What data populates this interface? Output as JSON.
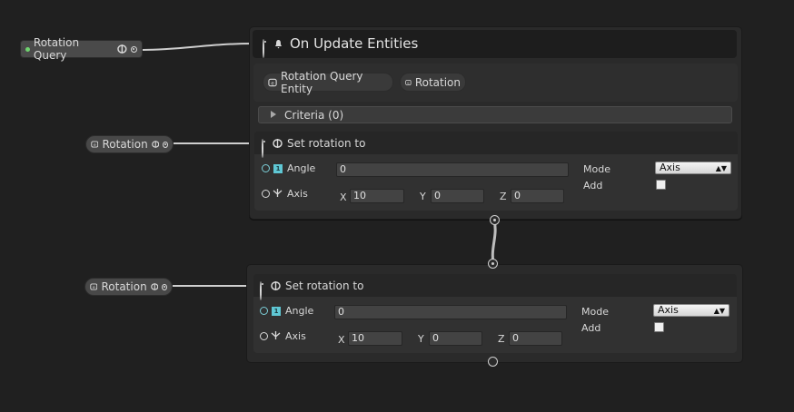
{
  "variables": {
    "rotation_query": "Rotation Query",
    "rotation_1": "Rotation",
    "rotation_2": "Rotation"
  },
  "event_node": {
    "title": "On Update Entities",
    "entity_tags": [
      "Rotation Query Entity",
      "Rotation"
    ],
    "criteria_label": "Criteria (0)"
  },
  "nodes": [
    {
      "title": "Set rotation to",
      "angle_label": "Angle",
      "angle_value": "0",
      "axis_label": "Axis",
      "axis_x_label": "X",
      "axis_x": "10",
      "axis_y_label": "Y",
      "axis_y": "0",
      "axis_z_label": "Z",
      "axis_z": "0",
      "mode_label": "Mode",
      "mode_value": "Axis",
      "add_label": "Add",
      "add_checked": false
    },
    {
      "title": "Set rotation to",
      "angle_label": "Angle",
      "angle_value": "0",
      "axis_label": "Axis",
      "axis_x_label": "X",
      "axis_x": "10",
      "axis_y_label": "Y",
      "axis_y": "0",
      "axis_z_label": "Z",
      "axis_z": "0",
      "mode_label": "Mode",
      "mode_value": "Axis",
      "add_label": "Add",
      "add_checked": false
    }
  ],
  "icons": {
    "data_port": "port-dot-icon",
    "rotation_type": "rotation-type-icon",
    "entity_type": "entity-type-icon",
    "number_type": "number-type-icon",
    "vector_type": "vector-type-icon"
  },
  "colors": {
    "canvas": "#202020",
    "node_body": "#313131",
    "wire": "#cfcfcf",
    "number_accent": "#5fc7d4",
    "query_dot": "#6fd36f"
  }
}
